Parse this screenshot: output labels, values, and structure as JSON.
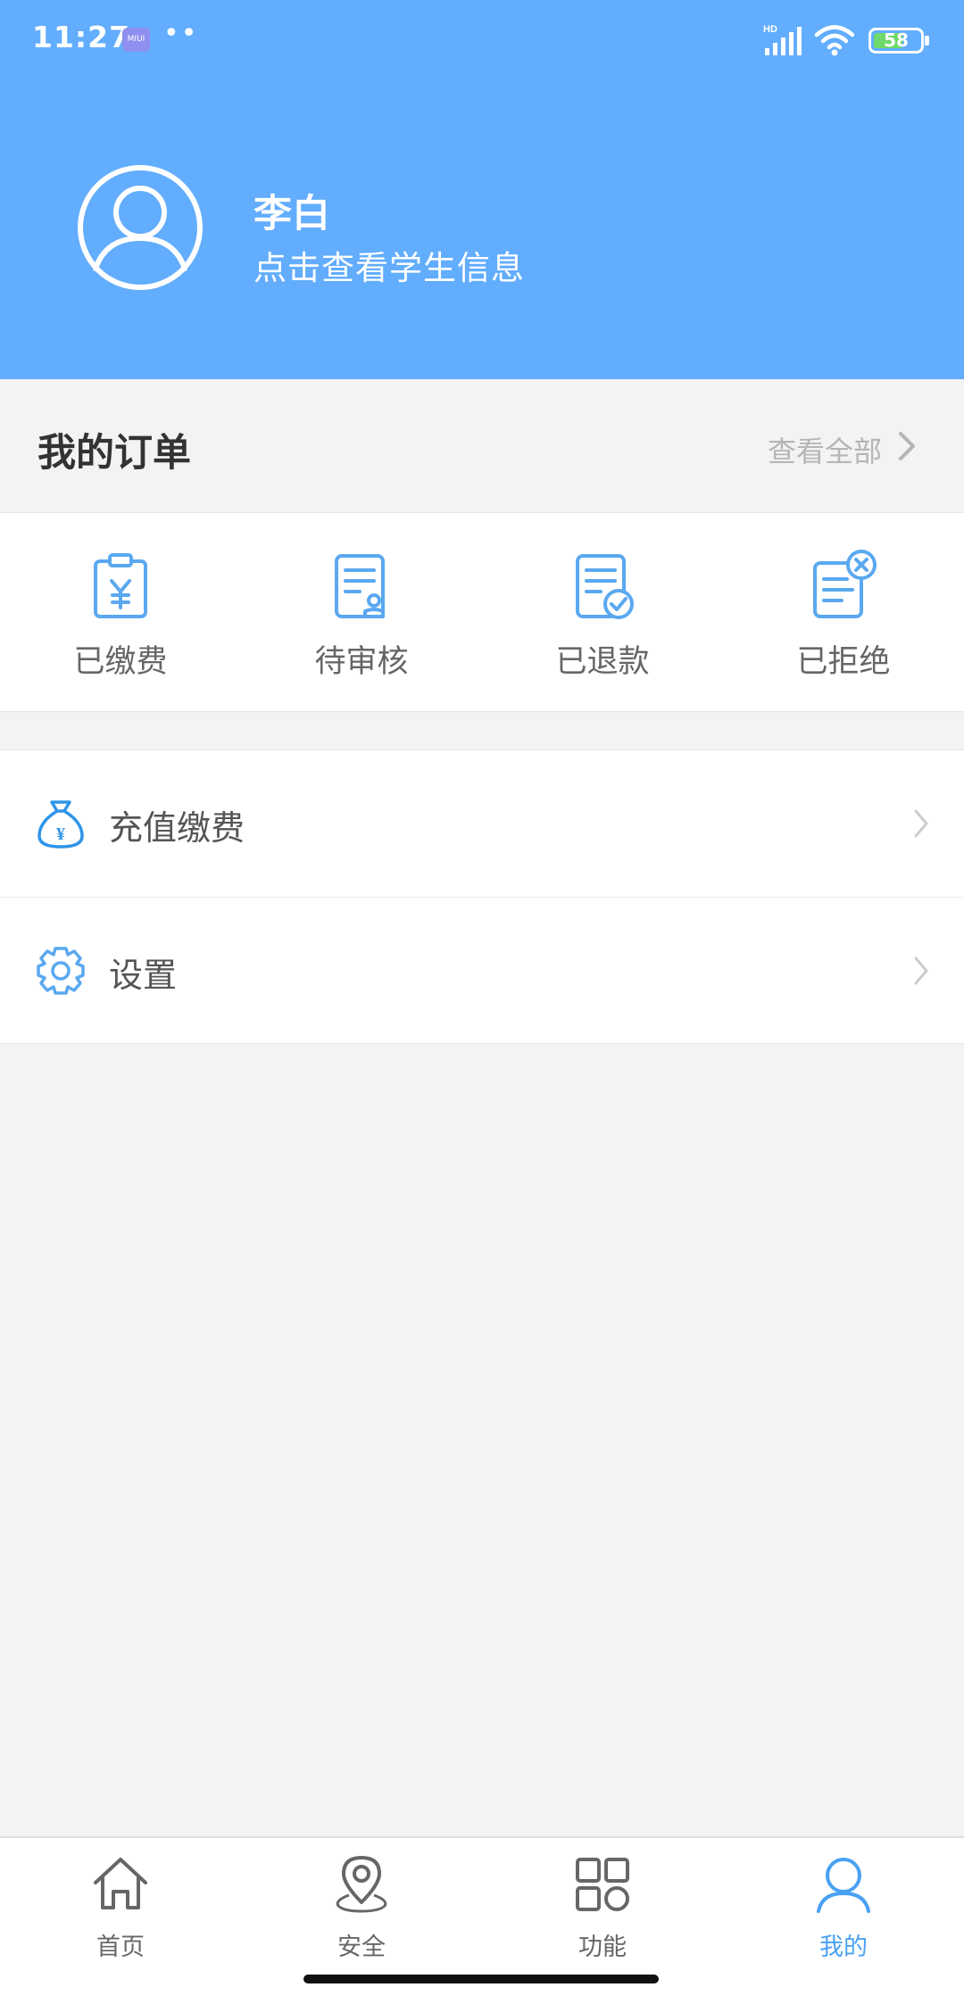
{
  "status_bar": {
    "time": "11:27",
    "miui_badge": "MIUI",
    "dots": "••",
    "network": "HD",
    "battery": "58"
  },
  "profile": {
    "name": "李白",
    "subtitle": "点击查看学生信息"
  },
  "orders": {
    "title": "我的订单",
    "view_all": "查看全部",
    "items": [
      {
        "label": "已缴费",
        "icon": "paid-clipboard-icon"
      },
      {
        "label": "待审核",
        "icon": "pending-review-icon"
      },
      {
        "label": "已退款",
        "icon": "refunded-check-icon"
      },
      {
        "label": "已拒绝",
        "icon": "rejected-x-icon"
      }
    ]
  },
  "menu": {
    "items": [
      {
        "label": "充值缴费",
        "icon": "money-bag-icon"
      },
      {
        "label": "设置",
        "icon": "gear-icon"
      }
    ]
  },
  "tabbar": {
    "items": [
      {
        "label": "首页",
        "icon": "home-icon"
      },
      {
        "label": "安全",
        "icon": "location-pin-icon"
      },
      {
        "label": "功能",
        "icon": "apps-grid-icon"
      },
      {
        "label": "我的",
        "icon": "user-icon"
      }
    ],
    "active_index": 3,
    "active_color": "#4aa1f3"
  },
  "colors": {
    "header_bg": "#62adfd",
    "icon_blue": "#5aa8f0",
    "page_bg": "#f3f3f3"
  }
}
